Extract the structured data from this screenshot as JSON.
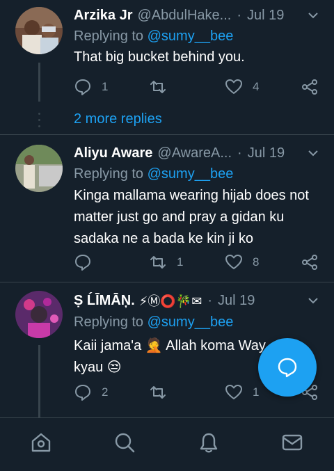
{
  "colors": {
    "background": "#15202b",
    "divider": "#38444d",
    "muted": "#8899a6",
    "accent": "#1da1f2",
    "name": "#ffffff"
  },
  "tweets": [
    {
      "name": "Arzika Jr",
      "handle": "@AbdulHake...",
      "dot": "·",
      "date": "Jul 19",
      "reply_prefix": "Replying to",
      "reply_to": "@sumy__bee",
      "text": "That big bucket behind you.",
      "reply_count": "1",
      "retweet_count": "",
      "like_count": "4",
      "more_replies": "2 more replies"
    },
    {
      "name": "Aliyu Aware",
      "handle": "@AwareA...",
      "dot": "·",
      "date": "Jul 19",
      "reply_prefix": "Replying to",
      "reply_to": "@sumy__bee",
      "text": "Kinga mallama wearing hijab does not matter just go and pray a gidan ku sadaka ne a bada ke kin ji ko",
      "reply_count": "",
      "retweet_count": "1",
      "like_count": "8"
    },
    {
      "name": "Ṣ ĹĪMĀŅ.",
      "name_emojis": "⚡Ⓜ⭕🎋✉",
      "dot": "·",
      "date": "Jul 19",
      "reply_prefix": "Replying to",
      "reply_to": "@sumy__bee",
      "text_line1": "Kaii jama'a 🤦 Allah koma Way...abu",
      "text_line2": "kyau 😒",
      "reply_count": "2",
      "retweet_count": "",
      "like_count": "1"
    }
  ],
  "icons": {
    "reply": "reply-icon",
    "retweet": "retweet-icon",
    "like": "heart-icon",
    "share": "share-icon",
    "more": "chevron-down-icon",
    "compose": "compose-reply-icon"
  },
  "nav": [
    "home-icon",
    "search-icon",
    "notifications-icon",
    "messages-icon"
  ]
}
